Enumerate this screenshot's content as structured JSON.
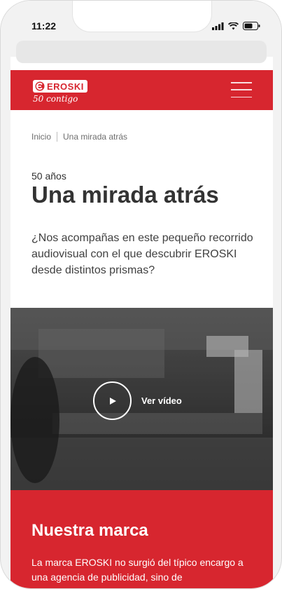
{
  "status": {
    "time": "11:22"
  },
  "header": {
    "logo_text": "EROSKI",
    "logo_sub": "50 contigo",
    "menu_icon": "hamburger-menu-icon"
  },
  "breadcrumb": {
    "home": "Inicio",
    "current": "Una mirada atrás"
  },
  "hero": {
    "eyebrow": "50 años",
    "title": "Una mirada atrás",
    "intro": "¿Nos acompañas en este pequeño recorrido audiovisual con el que descubrir EROSKI desde distintos prismas?"
  },
  "video": {
    "label": "Ver vídeo",
    "icon": "play-icon"
  },
  "brand": {
    "title": "Nuestra marca",
    "text": "La marca EROSKI no surgió del típico encargo a una agencia de publicidad, sino de"
  },
  "colors": {
    "brand_red": "#d7262f",
    "text_dark": "#333333"
  }
}
